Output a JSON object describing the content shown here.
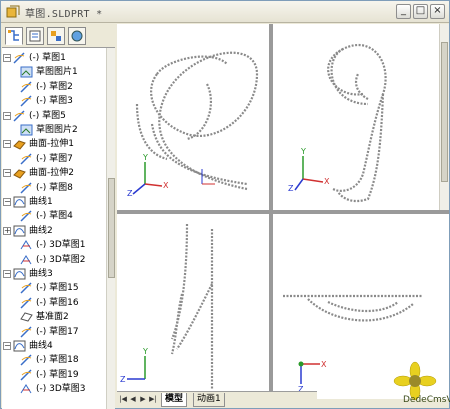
{
  "window": {
    "title": "草图.SLDPRT *",
    "controls": [
      "_",
      "□",
      "×"
    ]
  },
  "feature_tree": {
    "tabs": [
      "feature-manager",
      "property-manager",
      "configuration-manager",
      "display-manager"
    ],
    "items": [
      {
        "label": "(-) 草图1",
        "icon": "sketch-icon",
        "expand": "minus"
      },
      {
        "label": "草图图片1",
        "icon": "sketch-picture-icon",
        "expand": ""
      },
      {
        "label": "(-) 草图2",
        "icon": "sketch-icon",
        "expand": ""
      },
      {
        "label": "(-) 草图3",
        "icon": "sketch-icon",
        "expand": ""
      },
      {
        "label": "(-) 草图5",
        "icon": "sketch-icon",
        "expand": "minus"
      },
      {
        "label": "草图图片2",
        "icon": "sketch-picture-icon",
        "expand": ""
      },
      {
        "label": "曲面-拉伸1",
        "icon": "surface-extrude-icon",
        "expand": "minus"
      },
      {
        "label": "(-) 草图7",
        "icon": "sketch-icon",
        "expand": ""
      },
      {
        "label": "曲面-拉伸2",
        "icon": "surface-extrude-icon",
        "expand": "minus"
      },
      {
        "label": "(-) 草图8",
        "icon": "sketch-icon",
        "expand": ""
      },
      {
        "label": "曲线1",
        "icon": "curve-icon",
        "expand": "minus"
      },
      {
        "label": "(-) 草图4",
        "icon": "sketch-icon",
        "expand": ""
      },
      {
        "label": "曲线2",
        "icon": "curve-icon",
        "expand": "plus"
      },
      {
        "label": "(-) 3D草图1",
        "icon": "3d-sketch-icon",
        "expand": ""
      },
      {
        "label": "(-) 3D草图2",
        "icon": "3d-sketch-icon",
        "expand": ""
      },
      {
        "label": "曲线3",
        "icon": "curve-icon",
        "expand": "minus"
      },
      {
        "label": "(-) 草图15",
        "icon": "sketch-icon",
        "expand": ""
      },
      {
        "label": "(-) 草图16",
        "icon": "sketch-icon",
        "expand": ""
      },
      {
        "label": "基准面2",
        "icon": "plane-icon",
        "expand": ""
      },
      {
        "label": "(-) 草图17",
        "icon": "sketch-icon",
        "expand": ""
      },
      {
        "label": "曲线4",
        "icon": "curve-icon",
        "expand": "minus"
      },
      {
        "label": "(-) 草图18",
        "icon": "sketch-icon",
        "expand": ""
      },
      {
        "label": "(-) 草图19",
        "icon": "sketch-icon",
        "expand": ""
      },
      {
        "label": "(-) 3D草图3",
        "icon": "3d-sketch-icon",
        "expand": ""
      }
    ]
  },
  "viewports": {
    "axis_labels": {
      "x": "X",
      "y": "Y",
      "z": "Z"
    },
    "views": [
      "isometric",
      "front",
      "right",
      "top"
    ]
  },
  "sheet_tabs": {
    "nav": [
      "|◀",
      "◀",
      "▶",
      "▶|"
    ],
    "tabs": [
      "模型",
      "动画1"
    ],
    "active": "模型"
  },
  "watermark": "DedeCmsV3",
  "colors": {
    "axis_x": "#d03030",
    "axis_y": "#2a9a2a",
    "axis_z": "#2a3ad0",
    "curve": "#7a7a7a",
    "tree_icon_blue": "#3a6ec8",
    "tree_icon_orange": "#e8a020"
  }
}
